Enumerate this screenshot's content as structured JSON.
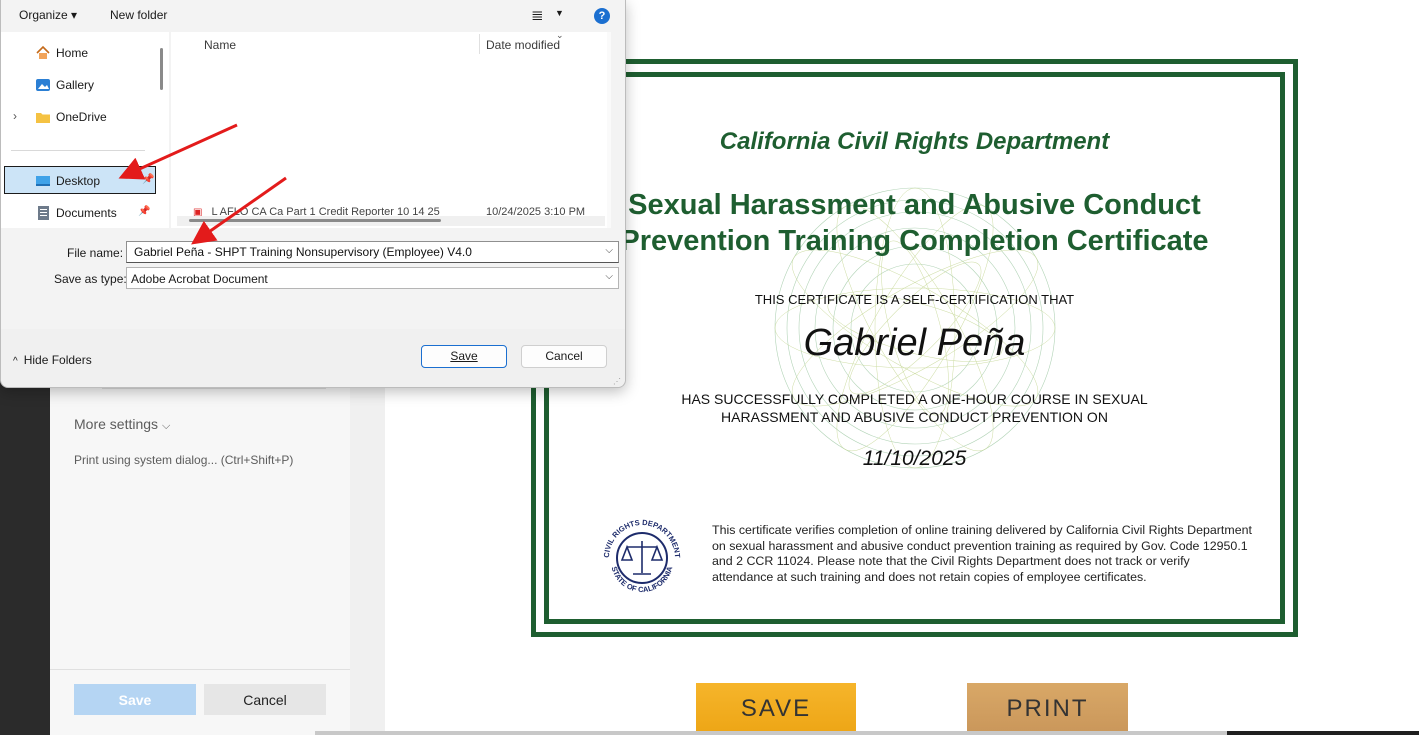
{
  "dialog": {
    "toolbar": {
      "organize": "Organize ▾",
      "new_folder": "New folder",
      "view_icon": "≣",
      "view_arrow": "▼",
      "help": "?"
    },
    "nav": [
      {
        "label": "Home",
        "icon": "home-icon"
      },
      {
        "label": "Gallery",
        "icon": "gallery-icon"
      },
      {
        "label": "OneDrive",
        "icon": "folder-icon"
      },
      {
        "label": "Desktop",
        "icon": "desktop-icon",
        "selected": true
      },
      {
        "label": "Documents",
        "icon": "documents-icon"
      }
    ],
    "columns": {
      "name": "Name",
      "date_modified": "Date modified"
    },
    "partial_file": {
      "name": "L AFLO CA Ca Part 1 Credit Reporter 10 14 25",
      "date": "10/24/2025 3:10 PM"
    },
    "file_name_label": "File name:",
    "file_name_value": "Gabriel Peña - SHPT Training Nonsupervisory (Employee) V4.0",
    "save_type_label": "Save as type:",
    "save_type_value": "Adobe Acrobat Document",
    "hide_folders": "Hide Folders",
    "save_button": "Save",
    "cancel_button": "Cancel"
  },
  "print_panel": {
    "more_settings": "More settings",
    "system_dialog": "Print using system dialog... (Ctrl+Shift+P)",
    "save_button": "Save",
    "cancel_button": "Cancel"
  },
  "certificate": {
    "department": "California Civil Rights Department",
    "title_line1": "Sexual Harassment and Abusive Conduct",
    "title_line2": "Prevention Training Completion Certificate",
    "intro": "THIS CERTIFICATE IS A SELF-CERTIFICATION THAT",
    "name": "Gabriel Peña",
    "completed_line1": "HAS SUCCESSFULLY COMPLETED A ONE-HOUR COURSE IN SEXUAL",
    "completed_line2": "HARASSMENT AND ABUSIVE CONDUCT PREVENTION ON",
    "date": "11/10/2025",
    "seal_top": "CIVIL RIGHTS DEPARTMENT",
    "seal_bottom": "STATE OF CALIFORNIA",
    "fine_print": "This certificate verifies completion of online training delivered by California Civil Rights Department on sexual harassment and abusive conduct prevention training as required by Gov. Code 12950.1 and 2 CCR 11024. Please note that the Civil Rights Department does not track or verify attendance at such training and does not retain copies of employee certificates.",
    "border_color": "#1e5e30"
  },
  "page_buttons": {
    "save": "SAVE",
    "print": "PRINT"
  },
  "colors": {
    "accent": "#1b6fd0",
    "cert_green": "#1e5e30",
    "save_orange": "#f2ad22",
    "print_tan": "#d1a062",
    "arrow_red": "#e31b1b"
  }
}
